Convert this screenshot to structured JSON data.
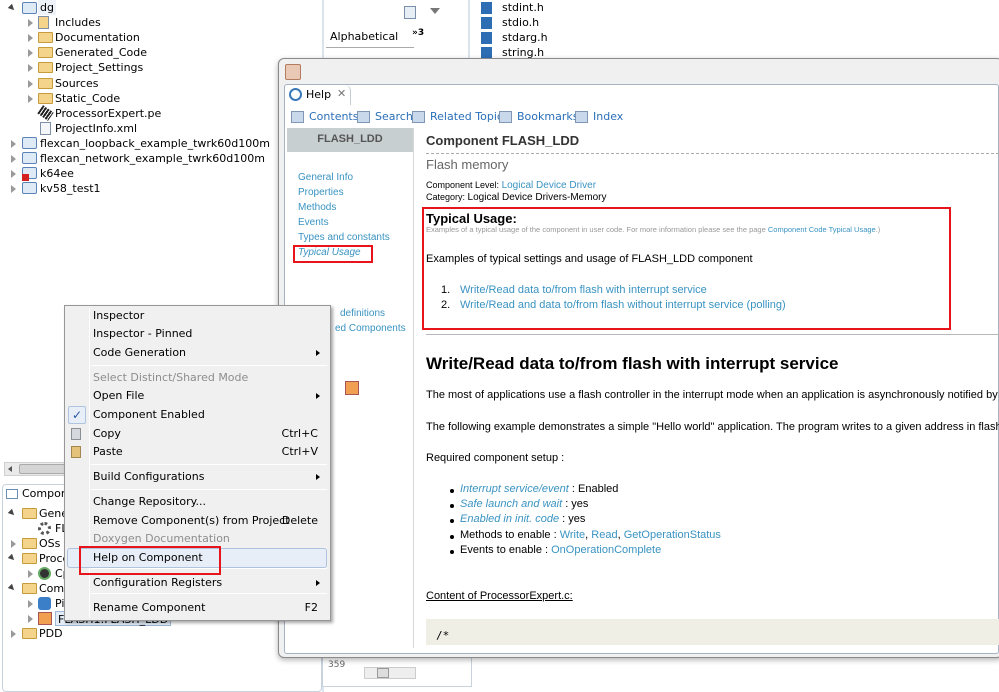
{
  "project_tree": {
    "root": "dg",
    "children": [
      "Includes",
      "Documentation",
      "Generated_Code",
      "Project_Settings",
      "Sources",
      "Static_Code",
      "ProcessorExpert.pe",
      "ProjectInfo.xml"
    ],
    "projects": [
      "flexcan_loopback_example_twrk60d100m",
      "flexcan_network_example_twrk60d100m",
      "k64ee",
      "kv58_test1"
    ]
  },
  "outline_panel": {
    "tab": "Alphabetical",
    "overflow": "»3"
  },
  "includes_list": [
    "stdint.h",
    "stdio.h",
    "stdarg.h",
    "string.h"
  ],
  "components_panel": {
    "title": "Compone",
    "items": [
      "Gener",
      "FL",
      "OSs",
      "Proce",
      "Cp",
      "Comp",
      "Pi",
      "FLASH1:FLASH_LDD",
      "PDD"
    ]
  },
  "context_menu": {
    "items": [
      {
        "label": "Inspector"
      },
      {
        "label": "Inspector - Pinned"
      },
      {
        "label": "Code Generation",
        "submenu": true
      },
      {
        "label": "Select Distinct/Shared Mode",
        "disabled": true
      },
      {
        "label": "Open File",
        "submenu": true
      },
      {
        "label": "Component Enabled",
        "checked": true
      },
      {
        "label": "Copy",
        "shortcut": "Ctrl+C"
      },
      {
        "label": "Paste",
        "shortcut": "Ctrl+V"
      },
      {
        "label": "Build Configurations",
        "submenu": true
      },
      {
        "label": "Change Repository..."
      },
      {
        "label": "Remove Component(s) from Project",
        "shortcut": "Delete"
      },
      {
        "label": "Doxygen Documentation",
        "disabled": true
      },
      {
        "label": "Help on Component",
        "highlighted": true
      },
      {
        "label": "Configuration Registers",
        "submenu": true
      },
      {
        "label": "Rename Component",
        "shortcut": "F2"
      }
    ]
  },
  "help": {
    "tab": "Help",
    "toolbar": [
      "Contents",
      "Search",
      "Related Topics",
      "Bookmarks",
      "Index"
    ],
    "nav_header": "FLASH_LDD",
    "nav": [
      "General Info",
      "Properties",
      "Methods",
      "Events",
      "Types and constants",
      "Typical Usage"
    ],
    "nav_partial": [
      "definitions",
      "ed Components"
    ],
    "title": "Component FLASH_LDD",
    "subtitle": "Flash memory",
    "level_label": "Component Level:",
    "level_value": "Logical Device Driver",
    "category_label": "Category:",
    "category_value": "Logical Device Drivers-Memory",
    "typical_usage": {
      "heading": "Typical Usage:",
      "note": "Examples of a typical usage of the component in user code. For more information please see the page ",
      "note_link": "Component Code Typical Usage",
      "note_end": ".)",
      "intro": "Examples of typical settings and usage of FLASH_LDD component",
      "list": [
        "Write/Read data to/from flash with interrupt service",
        "Write/Read and data to/from flash without interrupt service (polling)"
      ]
    },
    "section_heading": "Write/Read data to/from flash with interrupt service",
    "para1": "The most of applications use a flash controller in the interrupt mode when an application is asynchronously notified by a driver",
    "para2": "The following example demonstrates a simple \"Hello world\" application. The program writes to a given address in flash mem",
    "setup_label": "Required component setup :",
    "setup": [
      {
        "link": "Interrupt service/event",
        "text": " : Enabled"
      },
      {
        "link": "Safe launch and wait",
        "text": " : yes"
      },
      {
        "link": "Enabled in init. code",
        "text": " : yes"
      }
    ],
    "methods_label": "Methods to enable : ",
    "methods": [
      "Write",
      "Read",
      "GetOperationStatus"
    ],
    "events_label": "Events to enable : ",
    "events": [
      "OnOperationComplete"
    ],
    "content_label": "Content of ProcessorExpert.c:",
    "code": "/*"
  },
  "bottom_fragment": "359",
  "colors": {
    "link": "#3993c2",
    "highlight_box": "#e8141b",
    "nav_header_bg": "#c8cfd1"
  }
}
